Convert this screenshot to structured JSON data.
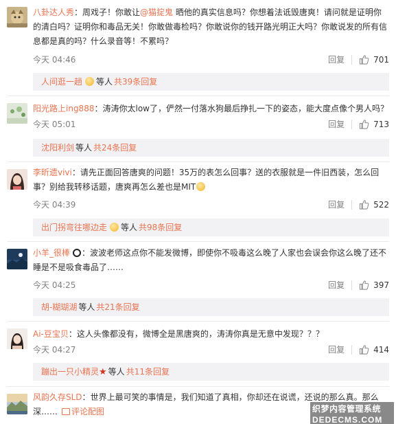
{
  "comments": [
    {
      "user": "八卦达人秀",
      "text_before": "周戏子！你敢让",
      "mention": "@猫掟鬼",
      "text_after": " 晒他的真实信息吗？你想着法诋毁唐爽！请问就是证明你的清白吗？证明你和毒品无关！你敢做毒检吗？你敢说你的钱开路光明正大吗？你敢说发的所有信息都是真的吗？什么录音等！不累吗？",
      "time": "今天 04:46",
      "reply_label": "回复",
      "likes": "701",
      "reply_box": {
        "who": "人间逛一趟",
        "etc": "等人",
        "count": "共39条回复"
      }
    },
    {
      "user": "阳光路上ing888",
      "text": "涛涛你太low了，俨然一付落水狗最后挣扎一下的姿态，能大度点像个男人吗？",
      "time": "今天 05:01",
      "reply_label": "回复",
      "likes": "713",
      "reply_box": {
        "who": "沈阳利剑",
        "etc": "等人",
        "count": "共24条回复"
      }
    },
    {
      "user": "李昕遗vivi",
      "text": "请先正面回答唐爽的问题！35万的表怎么回事？送的衣服就是一件旧西装，怎么回事？别给我转移话题，唐爽再怎么差也是MIT",
      "time": "今天 04:39",
      "reply_label": "回复",
      "likes": "522",
      "reply_box": {
        "who": "出门拐弯往哪边走",
        "etc": "等人",
        "count": "共98条回复"
      }
    },
    {
      "user": "小羊_很棒",
      "text": "波波老师这点你不能发微博，即使你不吸毒这么晚了人家也会误会你这么晚了还不睡是不是吸食毒品了……",
      "time": "今天 04:25",
      "reply_label": "回复",
      "likes": "397",
      "reply_box": {
        "who": "胡-糊瑚湖",
        "etc": "等人",
        "count": "共21条回复"
      }
    },
    {
      "user": "Ai-豆宝贝",
      "text": "这人头像都没有，微博全是黑唐爽的，涛涛你真是无意中发现？？？",
      "time": "今天 04:27",
      "reply_label": "回复",
      "likes": "414",
      "reply_box": {
        "who": "蹦出一只小精灵",
        "etc": "等人",
        "count": "共11条回复"
      }
    },
    {
      "user": "风韵久存SLD",
      "text": "世界上最可笑的事情是，我们知道了真相，你却还在说谎，还说的那么真。那么深……",
      "pic_label": "评论配图"
    }
  ],
  "watermark": {
    "line1": "织梦内容管理系统",
    "line2": "DEDECMS.COM"
  },
  "colors": {
    "link": "#eb7350",
    "meta": "#808080",
    "reply_bg": "#f2f2f5"
  },
  "icons": {
    "like": "thumbs-up-icon",
    "picture": "picture-icon"
  }
}
